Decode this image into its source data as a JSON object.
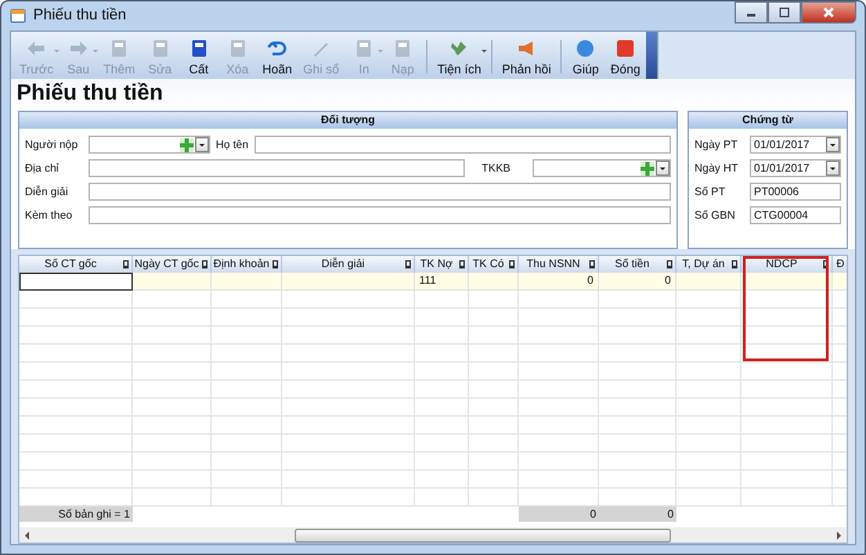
{
  "window": {
    "title": "Phiếu thu tiền"
  },
  "toolbar": [
    {
      "label": "Trước",
      "disabled": true,
      "dropdown": true
    },
    {
      "label": "Sau",
      "disabled": true,
      "dropdown": true
    },
    {
      "label": "Thêm",
      "disabled": true,
      "dropdown": false
    },
    {
      "label": "Sửa",
      "disabled": true,
      "dropdown": false
    },
    {
      "label": "Cất",
      "disabled": false,
      "dropdown": false
    },
    {
      "label": "Xóa",
      "disabled": true,
      "dropdown": false
    },
    {
      "label": "Hoãn",
      "disabled": false,
      "dropdown": false
    },
    {
      "label": "Ghi sổ",
      "disabled": true,
      "dropdown": false
    },
    {
      "label": "In",
      "disabled": true,
      "dropdown": true
    },
    {
      "label": "Nạp",
      "disabled": true,
      "dropdown": false
    },
    {
      "label": "Tiện ích",
      "disabled": false,
      "dropdown": true
    },
    {
      "label": "Phản hồi",
      "disabled": false,
      "dropdown": false
    },
    {
      "label": "Giúp",
      "disabled": false,
      "dropdown": false
    },
    {
      "label": "Đóng",
      "disabled": false,
      "dropdown": false
    }
  ],
  "heading": "Phiếu thu tiền",
  "doi_tuong": {
    "title": "Đối tượng",
    "fields": [
      {
        "label": "Người nộp",
        "kind": "combo"
      },
      {
        "label": "Họ tên",
        "kind": "text"
      },
      {
        "label": "Địa chỉ",
        "kind": "text"
      },
      {
        "label": "TKKB",
        "kind": "combo"
      },
      {
        "label": "Diễn giải",
        "kind": "text"
      },
      {
        "label": "Kèm theo",
        "kind": "text"
      }
    ]
  },
  "chung_tu": {
    "title": "Chứng từ",
    "fields": [
      {
        "label": "Ngày PT",
        "kind": "date",
        "value": "01/01/2017"
      },
      {
        "label": "Ngày HT",
        "kind": "date",
        "value": "01/01/2017"
      },
      {
        "label": "Số PT",
        "kind": "text",
        "value": "PT00006"
      },
      {
        "label": "Số GBN",
        "kind": "text",
        "value": "CTG00004"
      }
    ]
  },
  "table": {
    "columns": [
      {
        "label": "Số CT gốc",
        "highlighted": false
      },
      {
        "label": "Ngày CT gốc",
        "highlighted": false
      },
      {
        "label": "Định khoản",
        "highlighted": false
      },
      {
        "label": "Diễn giải",
        "highlighted": false
      },
      {
        "label": "TK Nợ",
        "highlighted": false
      },
      {
        "label": "TK Có",
        "highlighted": false
      },
      {
        "label": "Thu NSNN",
        "highlighted": false
      },
      {
        "label": "Số tiền",
        "highlighted": false
      },
      {
        "label": "T, Dự án",
        "highlighted": false
      },
      {
        "label": "NDCP",
        "highlighted": true
      },
      {
        "label": "Đ",
        "highlighted": false
      }
    ],
    "rows": [
      {
        "cells": [
          "",
          "",
          "",
          "",
          "111",
          "",
          "0",
          "0",
          "",
          "",
          ""
        ]
      }
    ],
    "footer": {
      "cells": [
        "Số bản ghi = 1",
        "",
        "",
        "",
        "",
        "",
        "0",
        "0",
        "",
        "",
        ""
      ]
    }
  }
}
